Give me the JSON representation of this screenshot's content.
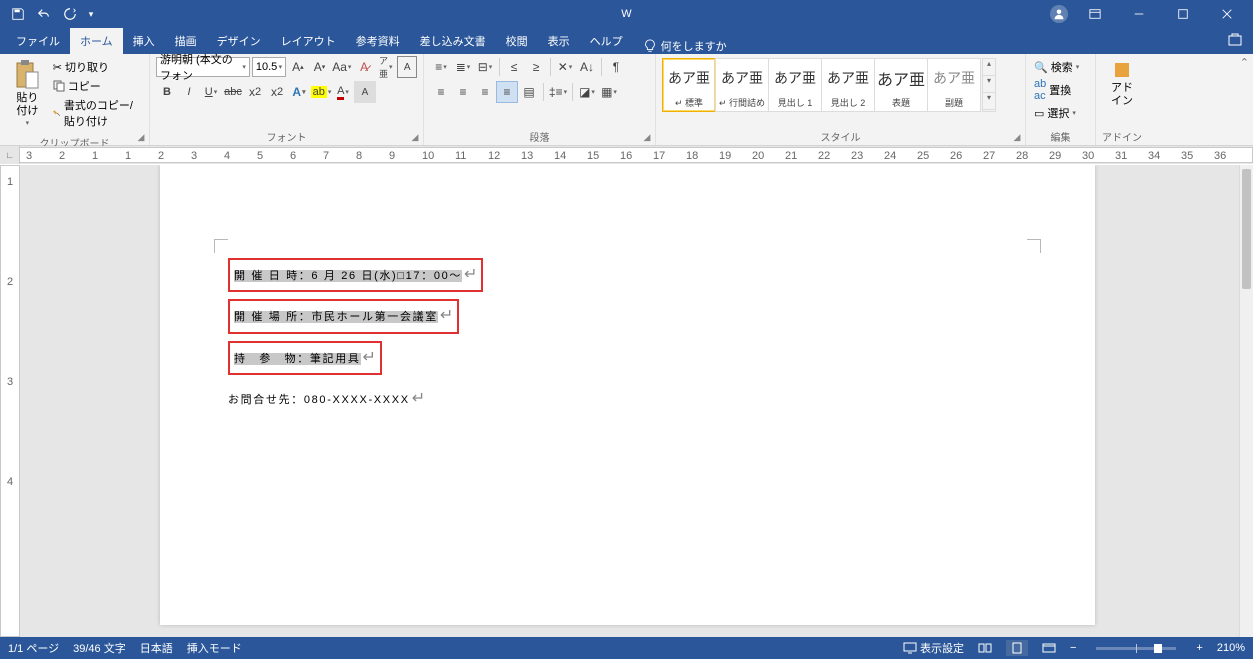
{
  "title": "W",
  "qat": {
    "save": "保存",
    "undo": "元に戻す",
    "redo": "やり直し",
    "more": "クイックアクセス"
  },
  "tabs": {
    "file": "ファイル",
    "home": "ホーム",
    "insert": "挿入",
    "draw": "描画",
    "design": "デザイン",
    "layout": "レイアウト",
    "references": "参考資料",
    "mailings": "差し込み文書",
    "review": "校閲",
    "view": "表示",
    "help": "ヘルプ"
  },
  "tellme": "何をしますか",
  "clipboard": {
    "label": "クリップボード",
    "paste": "貼り付け",
    "cut": "切り取り",
    "copy": "コピー",
    "formatpainter": "書式のコピー/貼り付け"
  },
  "font": {
    "label": "フォント",
    "name": "游明朝 (本文のフォン",
    "size": "10.5"
  },
  "paragraph": {
    "label": "段落"
  },
  "styles": {
    "label": "スタイル",
    "items": [
      {
        "preview": "あア亜",
        "name": "↵ 標準"
      },
      {
        "preview": "あア亜",
        "name": "↵ 行間詰め"
      },
      {
        "preview": "あア亜",
        "name": "見出し 1"
      },
      {
        "preview": "あア亜",
        "name": "見出し 2"
      },
      {
        "preview": "あア亜",
        "name": "表題"
      },
      {
        "preview": "あア亜",
        "name": "副題"
      }
    ]
  },
  "editing": {
    "label": "編集",
    "find": "検索",
    "replace": "置換",
    "select": "選択"
  },
  "addins": {
    "label": "アドイン",
    "btn": "アド\nイン"
  },
  "document": {
    "line1": "開 催 日 時：6 月 26 日(水)□17：00～",
    "line2": "開 催 場 所：市民ホール第一会議室",
    "line3": "持　参　物：筆記用具",
    "line4": "お問合せ先：080-XXXX-XXXX"
  },
  "status": {
    "page": "1/1 ページ",
    "words": "39/46 文字",
    "lang": "日本語",
    "mode": "挿入モード",
    "display": "表示設定",
    "zoom": "210%"
  }
}
